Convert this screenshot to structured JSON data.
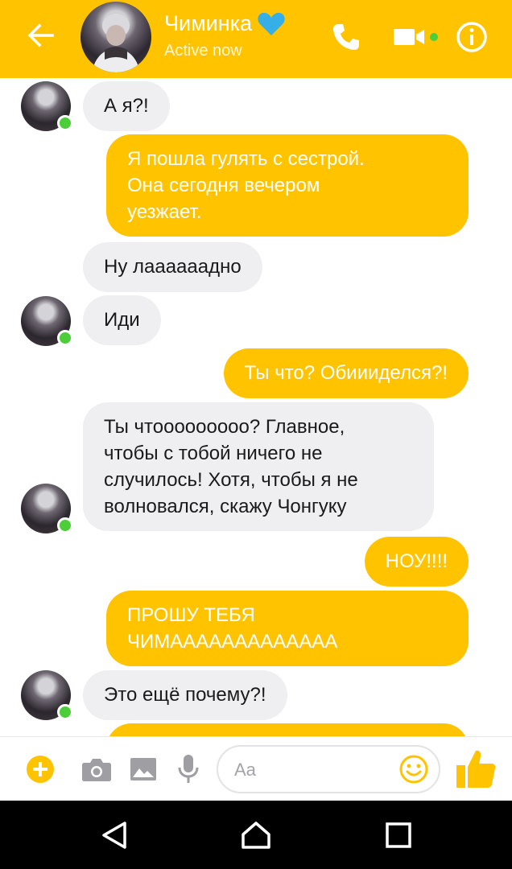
{
  "header": {
    "contact_name": "Чиминка",
    "status": "Active now",
    "accent_color": "#ffc300",
    "icons": [
      "back-arrow-icon",
      "heart-icon",
      "phone-icon",
      "video-camera-icon",
      "info-icon"
    ]
  },
  "messages": [
    {
      "sender": "contact",
      "text": "А я?!"
    },
    {
      "sender": "me",
      "text": "Я пошла гулять с сестрой.\nОна сегодня вечером\nуезжает."
    },
    {
      "sender": "contact",
      "text": "Ну лааааааднo"
    },
    {
      "sender": "contact",
      "text": "Иди"
    },
    {
      "sender": "me",
      "text": "Ты что? Обиииделся?!"
    },
    {
      "sender": "contact",
      "text": "Ты чтооооооооо? Главное,\nчтобы с тобой ничего не\nслучилось! Хотя,  чтобы я не\nволновался, скажу Чонгуку"
    },
    {
      "sender": "me",
      "text": "НОУ!!!!"
    },
    {
      "sender": "me",
      "text": "ПРОШУ ТЕБЯ\nЧИМААААААААААААА"
    },
    {
      "sender": "contact",
      "text": "Это ещё почему?!"
    }
  ],
  "composer": {
    "placeholder": "Aa",
    "icons": [
      "plus-icon",
      "camera-icon",
      "gallery-icon",
      "microphone-icon",
      "emoji-icon",
      "thumbs-up-icon"
    ]
  },
  "navbar": {
    "icons": [
      "nav-back-icon",
      "nav-home-icon",
      "nav-recent-icon"
    ]
  }
}
